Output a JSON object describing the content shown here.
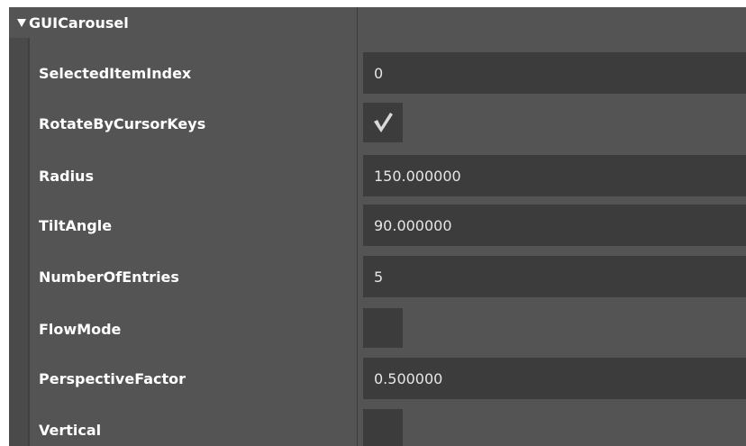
{
  "group": {
    "title": "GUICarousel",
    "expanded": true
  },
  "properties": [
    {
      "label": "SelectedItemIndex",
      "type": "text",
      "value": "0"
    },
    {
      "label": "RotateByCursorKeys",
      "type": "checkbox",
      "checked": true
    },
    {
      "label": "Radius",
      "type": "text",
      "value": "150.000000"
    },
    {
      "label": "TiltAngle",
      "type": "text",
      "value": "90.000000"
    },
    {
      "label": "NumberOfEntries",
      "type": "text",
      "value": "5"
    },
    {
      "label": "FlowMode",
      "type": "checkbox",
      "checked": false
    },
    {
      "label": "PerspectiveFactor",
      "type": "text",
      "value": "0.500000"
    },
    {
      "label": "Vertical",
      "type": "checkbox",
      "checked": false
    }
  ],
  "colors": {
    "panel_bg": "#545454",
    "field_bg": "#3c3c3c",
    "label_text": "#ffffff",
    "value_text": "#e6e6e6",
    "checkmark": "#d9d9d9"
  },
  "icons": {
    "expand": "triangle-down-icon",
    "check": "checkmark-icon"
  }
}
